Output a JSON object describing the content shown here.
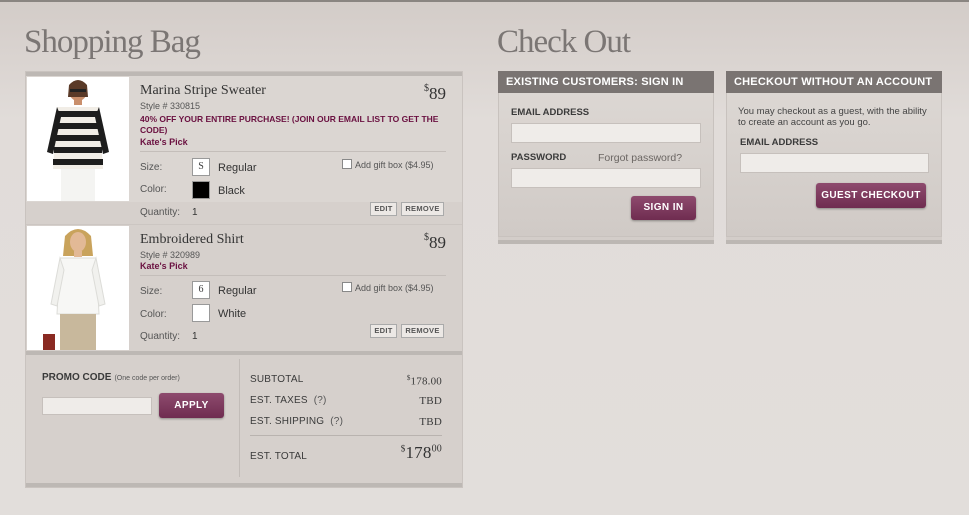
{
  "bag": {
    "heading": "Shopping Bag",
    "items": [
      {
        "name": "Marina Stripe Sweater",
        "style": "Style # 330815",
        "promo": "40% OFF YOUR ENTIRE PURCHASE! (JOIN OUR EMAIL LIST TO GET THE CODE)",
        "pick": "Kate's Pick",
        "price_symbol": "$",
        "price": "89",
        "size_label": "Size:",
        "size_box": "S",
        "size_value": "Regular",
        "color_label": "Color:",
        "color_value": "Black",
        "color_swatch": "#000000",
        "qty_label": "Quantity:",
        "qty": "1",
        "gift": "Add gift box ($4.95)",
        "edit": "EDIT",
        "remove": "REMOVE"
      },
      {
        "name": "Embroidered Shirt",
        "style": "Style # 320989",
        "pick": "Kate's Pick",
        "price_symbol": "$",
        "price": "89",
        "size_label": "Size:",
        "size_box": "6",
        "size_value": "Regular",
        "color_label": "Color:",
        "color_value": "White",
        "color_swatch": "#ffffff",
        "qty_label": "Quantity:",
        "qty": "1",
        "gift": "Add gift box ($4.95)",
        "edit": "EDIT",
        "remove": "REMOVE"
      }
    ],
    "promo": {
      "label": "PROMO CODE",
      "note": "(One code per order)",
      "input_value": "",
      "apply": "APPLY"
    },
    "totals": {
      "subtotal_label": "SUBTOTAL",
      "subtotal_symbol": "$",
      "subtotal_value": "178.00",
      "taxes_label": "EST. TAXES",
      "taxes_help": "(?)",
      "taxes_value": "TBD",
      "shipping_label": "EST. SHIPPING",
      "shipping_help": "(?)",
      "shipping_value": "TBD",
      "total_label": "EST. TOTAL",
      "total_symbol": "$",
      "total_value": "178",
      "total_cents": "00"
    }
  },
  "checkout": {
    "heading": "Check Out",
    "signin": {
      "title": "EXISTING CUSTOMERS: SIGN IN",
      "email_label": "EMAIL ADDRESS",
      "email_value": "",
      "password_label": "PASSWORD",
      "forgot": "Forgot password?",
      "password_value": "",
      "button": "SIGN IN"
    },
    "guest": {
      "title": "CHECKOUT WITHOUT AN ACCOUNT",
      "text": "You may checkout as a guest, with the ability to create an account as you go.",
      "email_label": "EMAIL ADDRESS",
      "email_value": "",
      "button": "GUEST CHECKOUT"
    }
  },
  "colors": {
    "accent": "#7a3a5e",
    "header_bar": "#7a7472",
    "pick_text": "#6a1040"
  }
}
